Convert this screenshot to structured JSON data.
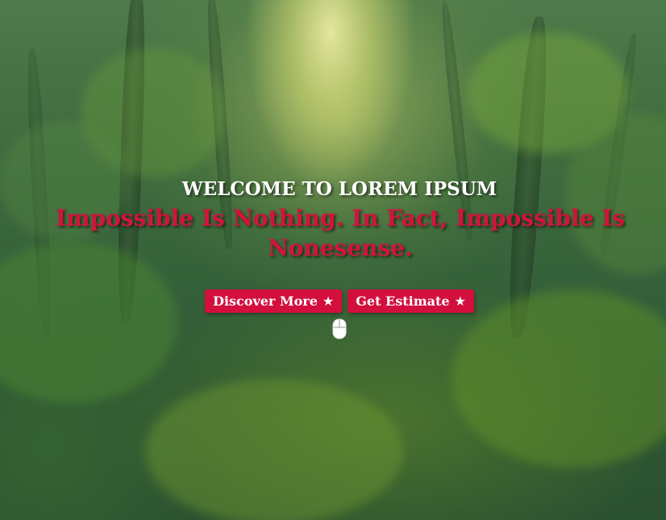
{
  "hero": {
    "welcome": "WELCOME TO LOREM IPSUM",
    "headline": "Impossible Is Nothing. In Fact, Impossible Is Nonesense.",
    "buttons": [
      {
        "label": "Discover More",
        "icon": "star-icon",
        "glyph": "★"
      },
      {
        "label": "Get Estimate",
        "icon": "star-icon",
        "glyph": "★"
      }
    ],
    "scroll_icon": "mouse-icon"
  },
  "colors": {
    "accent": "#d30f3e",
    "headline": "#d2143c",
    "welcome": "#ffffff"
  }
}
